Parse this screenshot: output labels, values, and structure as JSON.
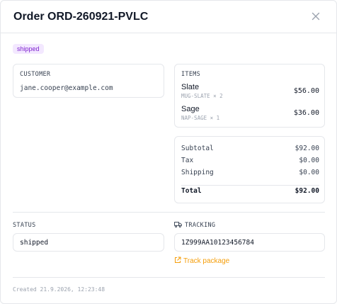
{
  "modal": {
    "title": "Order ORD-260921-PVLC",
    "status_badge": "shipped"
  },
  "customer": {
    "label": "CUSTOMER",
    "email": "jane.cooper@example.com"
  },
  "items": {
    "label": "ITEMS",
    "list": [
      {
        "name": "Slate",
        "sku": "MUG-SLATE × 2",
        "price": "$56.00"
      },
      {
        "name": "Sage",
        "sku": "NAP-SAGE × 1",
        "price": "$36.00"
      }
    ]
  },
  "totals": {
    "subtotal_label": "Subtotal",
    "subtotal": "$92.00",
    "tax_label": "Tax",
    "tax": "$0.00",
    "shipping_label": "Shipping",
    "shipping": "$0.00",
    "total_label": "Total",
    "total": "$92.00"
  },
  "status": {
    "label": "STATUS",
    "value": "shipped"
  },
  "tracking": {
    "label": "TRACKING",
    "number": "1Z999AA10123456784",
    "link_label": "Track package"
  },
  "footer": {
    "created": "Created 21.9.2026, 12:23:48"
  },
  "icons": {
    "close": "close-icon",
    "truck": "truck-icon",
    "external": "external-link-icon"
  },
  "colors": {
    "badge_bg": "#f3e8ff",
    "badge_text": "#7e22ce",
    "link": "#f59e0b"
  }
}
